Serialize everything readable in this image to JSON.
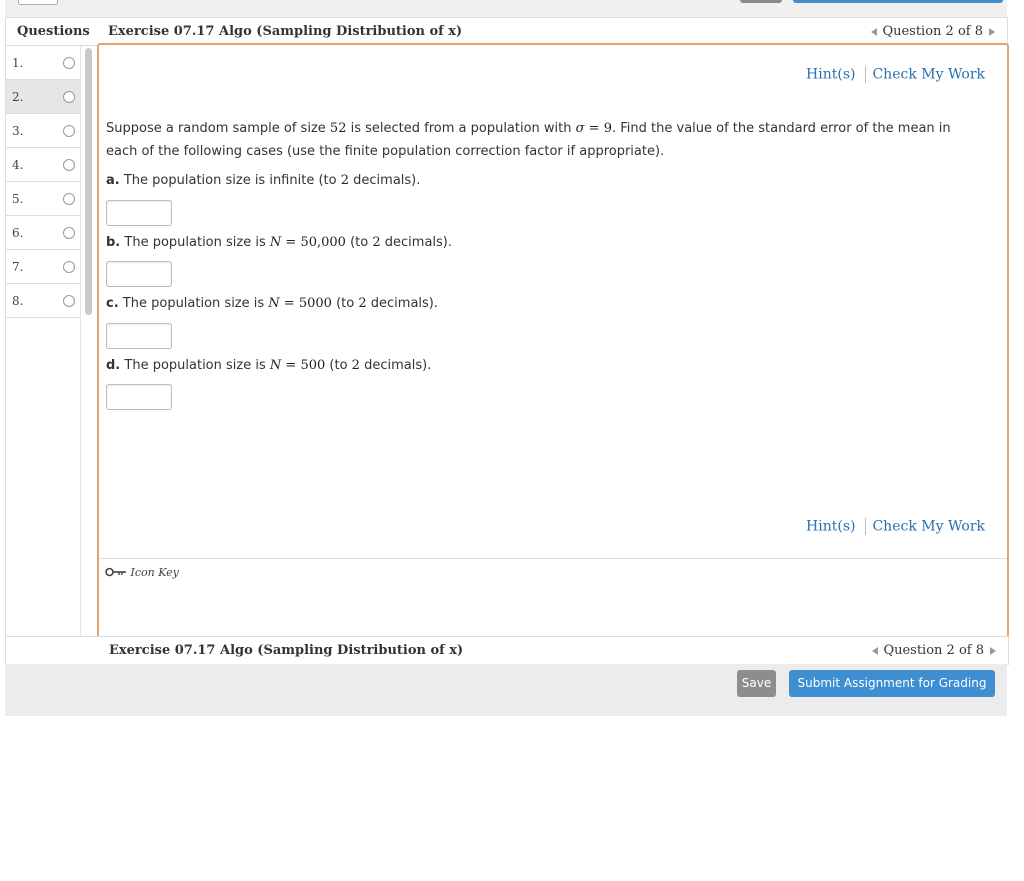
{
  "sidebar": {
    "header": "Questions",
    "items": [
      {
        "number": "1."
      },
      {
        "number": "2."
      },
      {
        "number": "3."
      },
      {
        "number": "4."
      },
      {
        "number": "5."
      },
      {
        "number": "6."
      },
      {
        "number": "7."
      },
      {
        "number": "8."
      }
    ],
    "active_index": 1
  },
  "header": {
    "title": "Exercise 07.17 Algo (Sampling Distribution of x)",
    "nav_text": "Question 2 of 8"
  },
  "hints": {
    "hint_label": "Hint(s)",
    "check_label": "Check My Work"
  },
  "question": {
    "intro_1": "Suppose a random sample of size",
    "sample_size": "52",
    "intro_2": "is selected from a population with",
    "sigma_symbol": "σ",
    "equals": "=",
    "sigma_value": "9",
    "intro_3": ". Find the value of the standard error of the mean in",
    "intro_4": "each of the following cases (use the finite population correction factor if appropriate).",
    "parts": [
      {
        "letter": "a.",
        "pre": "The population size is infinite (to",
        "n_symbol": "",
        "n_value": "",
        "dec": "2",
        "post": "decimals)."
      },
      {
        "letter": "b.",
        "pre": "The population size is",
        "n_symbol": "N",
        "n_value": "50,000",
        "dec": "2",
        "post": "decimals)."
      },
      {
        "letter": "c.",
        "pre": "The population size is",
        "n_symbol": "N",
        "n_value": "5000",
        "dec": "2",
        "post": "decimals)."
      },
      {
        "letter": "d.",
        "pre": "The population size is",
        "n_symbol": "N",
        "n_value": "500",
        "dec": "2",
        "post": "decimals)."
      }
    ],
    "to_label": "(to"
  },
  "icon_key": {
    "label": "Icon Key",
    "icon": "key-icon"
  },
  "footer": {
    "save_label": "Save",
    "submit_label": "Submit Assignment for Grading"
  },
  "colors": {
    "link": "#2a6fb0",
    "panel_border": "#e8a46e",
    "submit_bg": "#3d8fd2",
    "save_bg": "#8d8d8d"
  }
}
